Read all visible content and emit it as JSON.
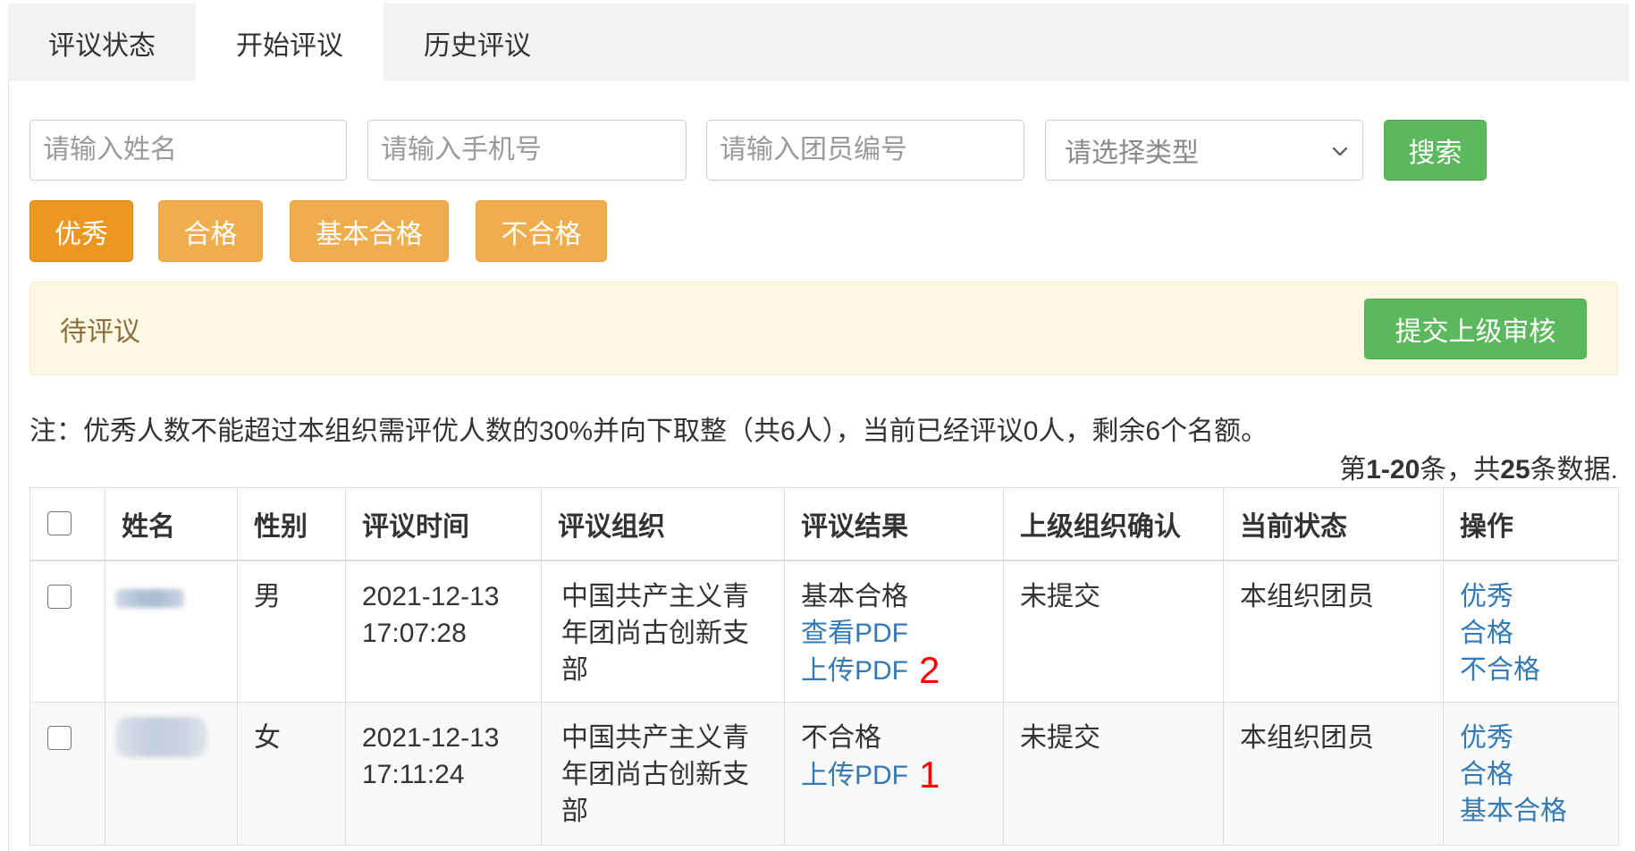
{
  "tabs": [
    {
      "label": "评议状态",
      "active": false
    },
    {
      "label": "开始评议",
      "active": true
    },
    {
      "label": "历史评议",
      "active": false
    }
  ],
  "search": {
    "name": {
      "value": "",
      "placeholder": "请输入姓名"
    },
    "phone": {
      "value": "",
      "placeholder": "请输入手机号"
    },
    "member_no": {
      "value": "",
      "placeholder": "请输入团员编号"
    },
    "type": {
      "selected": "请选择类型"
    },
    "button_label": "搜索"
  },
  "rating_buttons": [
    {
      "label": "优秀",
      "active": true
    },
    {
      "label": "合格",
      "active": false
    },
    {
      "label": "基本合格",
      "active": false
    },
    {
      "label": "不合格",
      "active": false
    }
  ],
  "alert": {
    "text": "待评议",
    "submit_label": "提交上级审核"
  },
  "note": "注：优秀人数不能超过本组织需评优人数的30%并向下取整（共6人），当前已经评议0人，剩余6个名额。",
  "summary": {
    "prefix": "第",
    "range": "1-20",
    "middle": "条，共",
    "total": "25",
    "suffix": "条数据."
  },
  "table": {
    "select_all_checked": false,
    "headers": [
      "姓名",
      "性别",
      "评议时间",
      "评议组织",
      "评议结果",
      "上级组织确认",
      "当前状态",
      "操作"
    ],
    "rows": [
      {
        "checked": false,
        "sex": "男",
        "review_time": "2021-12-13 17:07:28",
        "organization": "中国共产主义青年团尚古创新支部",
        "result": "基本合格",
        "result_links": [
          "查看PDF",
          "上传PDF"
        ],
        "annotation": "2",
        "superior_confirm": "未提交",
        "status": "本组织团员",
        "actions": [
          "优秀",
          "合格",
          "不合格"
        ]
      },
      {
        "checked": false,
        "sex": "女",
        "review_time": "2021-12-13 17:11:24",
        "organization": "中国共产主义青年团尚古创新支部",
        "result": "不合格",
        "result_links": [
          "上传PDF"
        ],
        "annotation": "1",
        "superior_confirm": "未提交",
        "status": "本组织团员",
        "actions": [
          "优秀",
          "合格",
          "基本合格"
        ]
      }
    ]
  },
  "icons": {
    "type_select": "chevron-down-icon"
  },
  "colors": {
    "success": "#5cb85c",
    "warning": "#f0ad4e",
    "warning_active": "#ec971f",
    "link": "#337ab7",
    "alert_background": "#fcf8e3",
    "alert_text": "#8a6d3b",
    "annotation": "#ff0000",
    "tabbar_background": "#f2f2f2"
  }
}
